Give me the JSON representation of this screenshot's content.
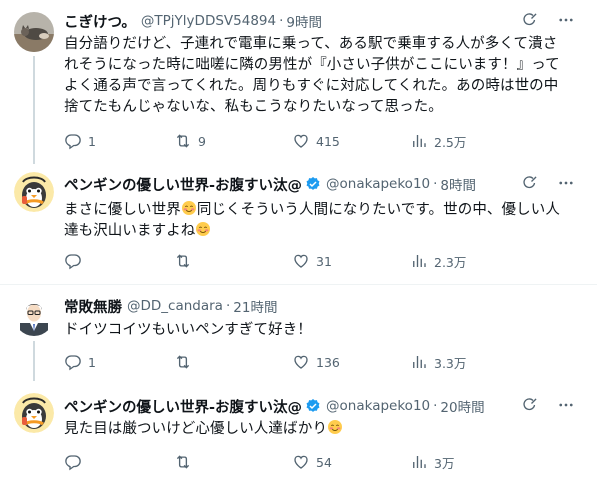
{
  "tweets": [
    {
      "name": "こぎけつ。",
      "handle": "@TPjYlyDDSV54894",
      "dot": "·",
      "time": "9時間",
      "lines": [
        "自分語りだけど、子連れで電車に乗って、ある駅で乗車する人が多くて潰さ",
        "れそうになった時に咄嗟に隣の男性が『小さい子供がここにいます！』って",
        "よく通る声で言ってくれた。周りもすぐに対応してくれた。あの時は世の中",
        "捨てたもんじゃないな、私もこうなりたいなって思った。"
      ],
      "replies": "1",
      "retweets": "9",
      "likes": "415",
      "views": "2.5万"
    },
    {
      "name": "ペンギンの優しい世界-お腹すい汰@",
      "handle": "@onakapeko10",
      "dot": "·",
      "time": "8時間",
      "line1_a": "まさに優しい世界",
      "line1_b": "同じくそういう人間になりたいです。世の中、優しい人",
      "line2": "達も沢山いますよね",
      "replies": "",
      "retweets": "",
      "likes": "31",
      "views": "2.3万"
    },
    {
      "name": "常敗無勝",
      "handle": "@DD_candara",
      "dot": "·",
      "time": "21時間",
      "line1": "ドイツコイツもいいペンすぎて好き！",
      "replies": "1",
      "retweets": "",
      "likes": "136",
      "views": "3.3万"
    },
    {
      "name": "ペンギンの優しい世界-お腹すい汰@",
      "handle": "@onakapeko10",
      "dot": "·",
      "time": "20時間",
      "line1": "見た目は厳ついけど心優しい人達ばかり",
      "replies": "",
      "retweets": "",
      "likes": "54",
      "views": "3万"
    }
  ],
  "icons": {
    "reply": "reply-icon",
    "retweet": "retweet-icon",
    "like": "heart-icon",
    "views": "views-bar-chart-icon",
    "grok": "grok-icon",
    "more": "more-icon",
    "verified": "verified-badge-icon",
    "emoji": "smiling-blush-emoji"
  },
  "colors": {
    "text": "#0f1419",
    "secondary": "#536471",
    "verified": "#1d9bf0",
    "divider": "#eff3f4",
    "thread_line": "#cfd9de"
  }
}
